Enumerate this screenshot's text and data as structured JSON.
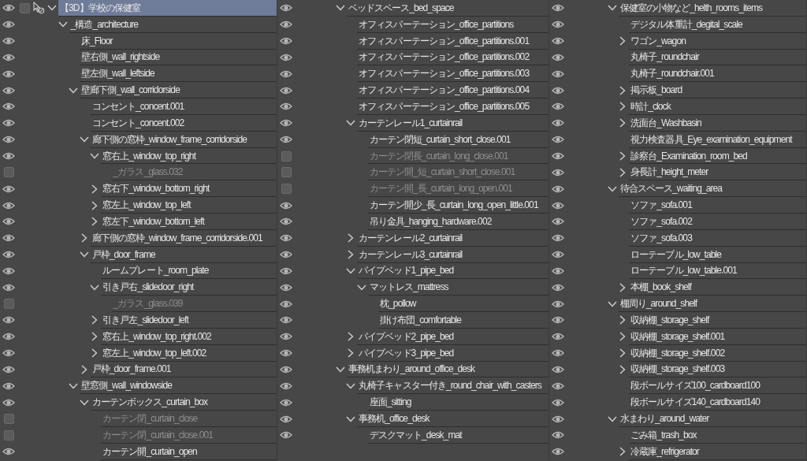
{
  "columns": [
    {
      "continued": false,
      "layers": [
        {
          "kind": "model",
          "name": "【3D】学校の保健室",
          "visible": true,
          "selected": true,
          "checked": false,
          "expanded": true,
          "children": [
            {
              "kind": "folder",
              "name": "_構造_architecture",
              "visible": true,
              "selected": false,
              "expanded": true,
              "children": [
                {
                  "kind": "layer",
                  "name": "床_Floor",
                  "visible": true,
                  "selected": false
                },
                {
                  "kind": "layer",
                  "name": "壁右側_wall_rightside",
                  "visible": true,
                  "selected": false
                },
                {
                  "kind": "layer",
                  "name": "壁左側_wall_leftside",
                  "visible": true,
                  "selected": false
                },
                {
                  "kind": "folder",
                  "name": "壁廊下側_wall_corridorside",
                  "visible": true,
                  "selected": false,
                  "expanded": true,
                  "children": [
                    {
                      "kind": "layer",
                      "name": "コンセント_concent.001",
                      "visible": true,
                      "selected": false
                    },
                    {
                      "kind": "layer",
                      "name": "コンセント_concent.002",
                      "visible": true,
                      "selected": false
                    },
                    {
                      "kind": "folder",
                      "name": "廊下側の窓枠_window_frame_corridorside",
                      "visible": true,
                      "selected": false,
                      "expanded": true,
                      "children": [
                        {
                          "kind": "folder",
                          "name": "窓右上_window_top_right",
                          "visible": true,
                          "selected": false,
                          "expanded": true,
                          "children": [
                            {
                              "kind": "layer",
                              "name": "_ガラス_glass.032",
                              "visible": false,
                              "selected": false
                            }
                          ]
                        },
                        {
                          "kind": "folder",
                          "name": "窓右下_window_bottom_right",
                          "visible": true,
                          "selected": false,
                          "expanded": false
                        },
                        {
                          "kind": "folder",
                          "name": "窓左上_window_top_left",
                          "visible": true,
                          "selected": false,
                          "expanded": false
                        },
                        {
                          "kind": "folder",
                          "name": "窓左下_window_bottom_left",
                          "visible": true,
                          "selected": false,
                          "expanded": false
                        }
                      ]
                    },
                    {
                      "kind": "folder",
                      "name": "廊下側の窓枠_window_frame_corridorside.001",
                      "visible": true,
                      "selected": false,
                      "expanded": false
                    },
                    {
                      "kind": "folder",
                      "name": "戸枠_door_frame",
                      "visible": true,
                      "selected": false,
                      "expanded": true,
                      "children": [
                        {
                          "kind": "layer",
                          "name": "ルームプレート_room_plate",
                          "visible": true,
                          "selected": false
                        },
                        {
                          "kind": "folder",
                          "name": "引き戸右_slidedoor_right",
                          "visible": true,
                          "selected": false,
                          "expanded": true,
                          "children": [
                            {
                              "kind": "layer",
                              "name": "_ガラス_glass.039",
                              "visible": false,
                              "selected": false
                            }
                          ]
                        },
                        {
                          "kind": "folder",
                          "name": "引き戸左_slidedoor_left",
                          "visible": true,
                          "selected": false,
                          "expanded": false
                        },
                        {
                          "kind": "folder",
                          "name": "窓右上_window_top_right.002",
                          "visible": true,
                          "selected": false,
                          "expanded": false
                        },
                        {
                          "kind": "folder",
                          "name": "窓左上_window_top_left.002",
                          "visible": true,
                          "selected": false,
                          "expanded": false
                        }
                      ]
                    },
                    {
                      "kind": "folder",
                      "name": "戸枠_door_frame.001",
                      "visible": true,
                      "selected": false,
                      "expanded": false
                    }
                  ]
                },
                {
                  "kind": "folder",
                  "name": "壁窓側_wall_windowside",
                  "visible": true,
                  "selected": false,
                  "expanded": true,
                  "children": [
                    {
                      "kind": "folder",
                      "name": "カーテンボックス_curtain_box",
                      "visible": true,
                      "selected": false,
                      "expanded": true,
                      "children": [
                        {
                          "kind": "layer",
                          "name": "カーテン閉_curtain_close",
                          "visible": false,
                          "selected": false
                        },
                        {
                          "kind": "layer",
                          "name": "カーテン閉_curtain_close.001",
                          "visible": false,
                          "selected": false
                        },
                        {
                          "kind": "layer",
                          "name": "カーテン開_curtain_open",
                          "visible": true,
                          "selected": false
                        }
                      ]
                    }
                  ]
                }
              ]
            }
          ]
        }
      ]
    },
    {
      "continued": true,
      "layers": [
        {
          "kind": "folder",
          "name": "ベッドスペース_bed_space",
          "visible": true,
          "selected": false,
          "expanded": true,
          "children": [
            {
              "kind": "layer",
              "name": "オフィスパーテーション_office_partitions",
              "visible": true,
              "selected": false
            },
            {
              "kind": "layer",
              "name": "オフィスパーテーション_office_partitions.001",
              "visible": true,
              "selected": false
            },
            {
              "kind": "layer",
              "name": "オフィスパーテーション_office_partitions.002",
              "visible": true,
              "selected": false
            },
            {
              "kind": "layer",
              "name": "オフィスパーテーション_office_partitions.003",
              "visible": true,
              "selected": false
            },
            {
              "kind": "layer",
              "name": "オフィスパーテーション_office_partitions.004",
              "visible": true,
              "selected": false
            },
            {
              "kind": "layer",
              "name": "オフィスパーテーション_office_partitions.005",
              "visible": true,
              "selected": false
            },
            {
              "kind": "folder",
              "name": "カーテンレール1_curtainrail",
              "visible": true,
              "selected": false,
              "expanded": true,
              "children": [
                {
                  "kind": "layer",
                  "name": "カーテン閉短_curtain_short_close.001",
                  "visible": true,
                  "selected": false
                },
                {
                  "kind": "layer",
                  "name": "カーテン閉長_curtain_long_close.001",
                  "visible": false,
                  "selected": false
                },
                {
                  "kind": "layer",
                  "name": "カーテン開_短_curtain_short_close.001",
                  "visible": false,
                  "selected": false
                },
                {
                  "kind": "layer",
                  "name": "カーテン開_長_curtain_long_open.001",
                  "visible": false,
                  "selected": false
                },
                {
                  "kind": "layer",
                  "name": "カーテン開少_長_curtain_long_open_little.001",
                  "visible": true,
                  "selected": false
                },
                {
                  "kind": "layer",
                  "name": "吊り金具_hanging_hardware.002",
                  "visible": true,
                  "selected": false
                }
              ]
            },
            {
              "kind": "folder",
              "name": "カーテンレール2_curtainrail",
              "visible": true,
              "selected": false,
              "expanded": false
            },
            {
              "kind": "folder",
              "name": "カーテンレール3_curtainrail",
              "visible": true,
              "selected": false,
              "expanded": false
            },
            {
              "kind": "folder",
              "name": "パイプベッド1_pipe_bed",
              "visible": true,
              "selected": false,
              "expanded": true,
              "children": [
                {
                  "kind": "folder",
                  "name": "マットレス_mattress",
                  "visible": true,
                  "selected": false,
                  "expanded": true,
                  "children": [
                    {
                      "kind": "layer",
                      "name": "枕_pollow",
                      "visible": true,
                      "selected": false
                    },
                    {
                      "kind": "layer",
                      "name": "掛け布団_comfortable",
                      "visible": true,
                      "selected": false
                    }
                  ]
                }
              ]
            },
            {
              "kind": "folder",
              "name": "パイプベッド2_pipe_bed",
              "visible": true,
              "selected": false,
              "expanded": false
            },
            {
              "kind": "folder",
              "name": "パイプベッド3_pipe_bed",
              "visible": true,
              "selected": false,
              "expanded": false
            }
          ]
        },
        {
          "kind": "folder",
          "name": "事務机まわり_around_office_desk",
          "visible": true,
          "selected": false,
          "expanded": true,
          "children": [
            {
              "kind": "folder",
              "name": "丸椅子キャスター付き_round_chair_with_casters",
              "visible": true,
              "selected": false,
              "expanded": true,
              "children": [
                {
                  "kind": "layer",
                  "name": "座面_sitting",
                  "visible": true,
                  "selected": false
                }
              ]
            },
            {
              "kind": "folder",
              "name": "事務机_office_desk",
              "visible": true,
              "selected": false,
              "expanded": true,
              "children": [
                {
                  "kind": "layer",
                  "name": "デスクマット_desk_mat",
                  "visible": true,
                  "selected": false
                }
              ]
            }
          ]
        }
      ]
    },
    {
      "continued": true,
      "layers": [
        {
          "kind": "folder",
          "name": "保健室の小物など_helth_rooms_items",
          "visible": true,
          "selected": false,
          "expanded": true,
          "children": [
            {
              "kind": "layer",
              "name": "デジタル体重計_degital_scale",
              "visible": true,
              "selected": false
            },
            {
              "kind": "folder",
              "name": "ワゴン_wagon",
              "visible": true,
              "selected": false,
              "expanded": false
            },
            {
              "kind": "layer",
              "name": "丸椅子_roundchair",
              "visible": true,
              "selected": false
            },
            {
              "kind": "layer",
              "name": "丸椅子_roundchair.001",
              "visible": true,
              "selected": false
            },
            {
              "kind": "folder",
              "name": "掲示板_board",
              "visible": true,
              "selected": false,
              "expanded": false
            },
            {
              "kind": "folder",
              "name": "時計_clock",
              "visible": true,
              "selected": false,
              "expanded": false
            },
            {
              "kind": "folder",
              "name": "洗面台_Washbasin",
              "visible": true,
              "selected": false,
              "expanded": false
            },
            {
              "kind": "layer",
              "name": "視力検査器具_Eye_examination_equipment",
              "visible": true,
              "selected": false
            },
            {
              "kind": "folder",
              "name": "診察台_Examination_room_bed",
              "visible": true,
              "selected": false,
              "expanded": false
            },
            {
              "kind": "folder",
              "name": "身長計_height_meter",
              "visible": true,
              "selected": false,
              "expanded": false
            }
          ]
        },
        {
          "kind": "folder",
          "name": "待合スペース_waiting_area",
          "visible": true,
          "selected": false,
          "expanded": true,
          "children": [
            {
              "kind": "layer",
              "name": "ソファ_sofa.001",
              "visible": true,
              "selected": false
            },
            {
              "kind": "layer",
              "name": "ソファ_sofa.002",
              "visible": true,
              "selected": false
            },
            {
              "kind": "layer",
              "name": "ソファ_sofa.003",
              "visible": true,
              "selected": false
            },
            {
              "kind": "layer",
              "name": "ローテーブル_low_table",
              "visible": true,
              "selected": false
            },
            {
              "kind": "layer",
              "name": "ローテーブル_low_table.001",
              "visible": true,
              "selected": false
            },
            {
              "kind": "folder",
              "name": "本棚_book_shelf",
              "visible": true,
              "selected": false,
              "expanded": false
            }
          ]
        },
        {
          "kind": "folder",
          "name": "棚周り_around_shelf",
          "visible": true,
          "selected": false,
          "expanded": true,
          "children": [
            {
              "kind": "folder",
              "name": "収納棚_storage_shelf",
              "visible": true,
              "selected": false,
              "expanded": false
            },
            {
              "kind": "folder",
              "name": "収納棚_storage_shelf.001",
              "visible": true,
              "selected": false,
              "expanded": false
            },
            {
              "kind": "folder",
              "name": "収納棚_storage_shelf.002",
              "visible": true,
              "selected": false,
              "expanded": false
            },
            {
              "kind": "folder",
              "name": "収納棚_storage_shelf.003",
              "visible": true,
              "selected": false,
              "expanded": false
            },
            {
              "kind": "layer",
              "name": "段ボールサイズ100_cardboard100",
              "visible": true,
              "selected": false
            },
            {
              "kind": "layer",
              "name": "段ボールサイズ140_cardboard140",
              "visible": true,
              "selected": false
            }
          ]
        },
        {
          "kind": "folder",
          "name": "水まわり_around_water",
          "visible": true,
          "selected": false,
          "expanded": true,
          "children": [
            {
              "kind": "layer",
              "name": "ごみ箱_trash_box",
              "visible": true,
              "selected": false
            },
            {
              "kind": "folder",
              "name": "冷蔵庫_refrigerator",
              "visible": true,
              "selected": false,
              "expanded": false
            }
          ]
        }
      ]
    }
  ]
}
